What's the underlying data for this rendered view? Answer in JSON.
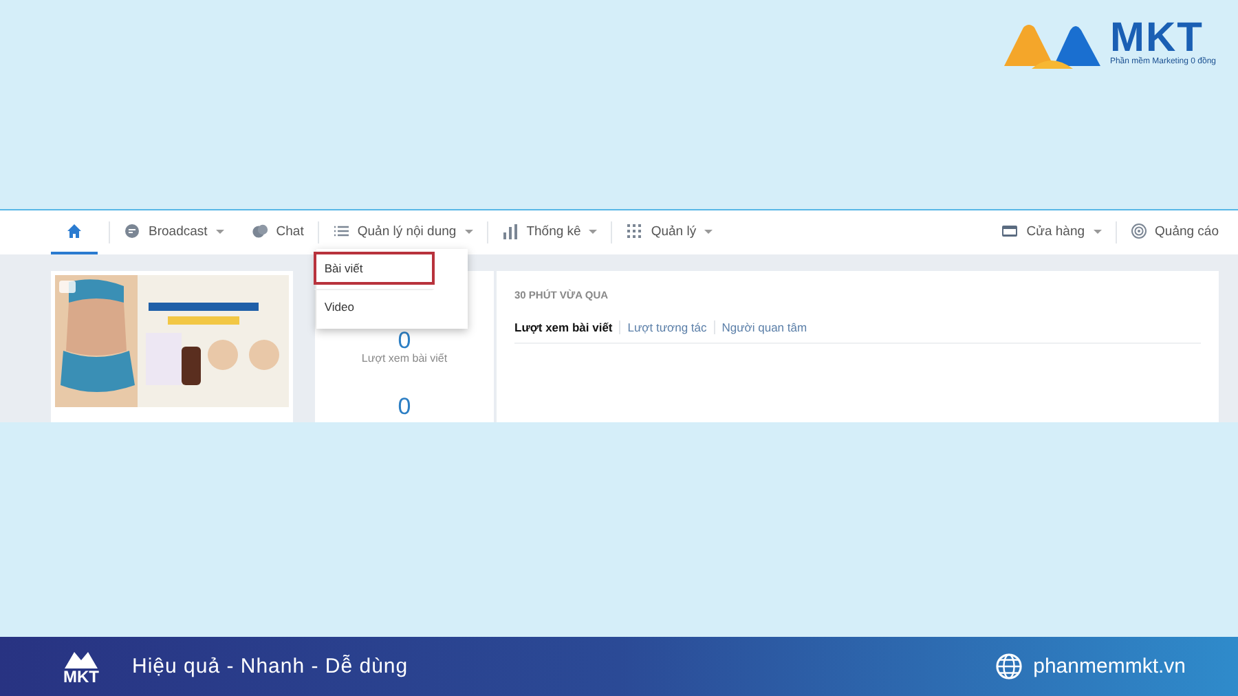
{
  "brand": {
    "name": "MKT",
    "tagline": "Phần mềm Marketing 0 đồng"
  },
  "nav": {
    "left_groups": [
      [
        {
          "kind": "home",
          "selected": true
        }
      ],
      [
        {
          "kind": "broadcast",
          "label": "Broadcast",
          "dropdown": true,
          "selected": false
        },
        {
          "kind": "chat",
          "label": "Chat",
          "dropdown": false,
          "selected": false
        }
      ],
      [
        {
          "kind": "list",
          "label": "Quản lý nội dung",
          "dropdown": true,
          "selected": false,
          "menu": [
            {
              "label": "Bài viết",
              "selected": true
            },
            {
              "label": "Video",
              "selected": false
            }
          ]
        }
      ],
      [
        {
          "kind": "bars",
          "label": "Thống kê",
          "dropdown": true,
          "selected": false
        }
      ],
      [
        {
          "kind": "grid",
          "label": "Quản lý",
          "dropdown": true,
          "selected": false
        }
      ]
    ],
    "right_groups": [
      [
        {
          "kind": "store",
          "label": "Cửa hàng",
          "dropdown": true,
          "selected": false
        }
      ],
      [
        {
          "kind": "target",
          "label": "Quảng cáo",
          "dropdown": false,
          "selected": false
        }
      ]
    ]
  },
  "stats": [
    {
      "value": "0",
      "label": "Lượt xem bài viết"
    },
    {
      "value": "0"
    }
  ],
  "panel": {
    "title": "30 PHÚT VỪA QUA",
    "tabs": [
      {
        "label": "Lượt xem bài viết",
        "selected": true
      },
      {
        "label": "Lượt tương tác",
        "selected": false
      },
      {
        "label": "Người quan tâm",
        "selected": false
      }
    ]
  },
  "footer": {
    "logo": "MKT",
    "slogan": "Hiệu quả - Nhanh - Dễ dùng",
    "website": "phanmemmkt.vn"
  }
}
